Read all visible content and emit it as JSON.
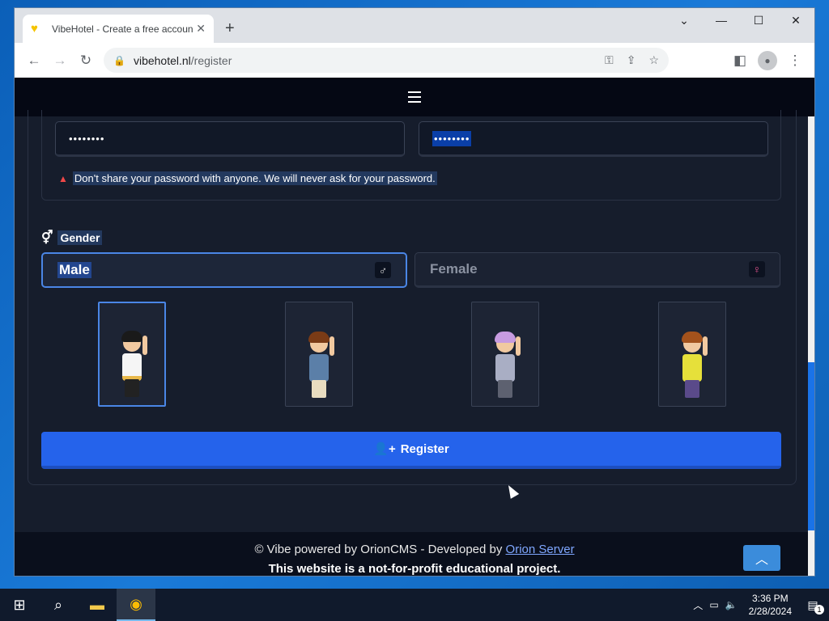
{
  "browser": {
    "tab_title": "VibeHotel - Create a free account",
    "tab_favicon": "heart-icon",
    "url_host": "vibehotel.nl",
    "url_path": "/register"
  },
  "page": {
    "password_masked": "••••••••",
    "password_confirm_masked": "••••••••",
    "password_warning": "Don't share your password with anyone. We will never ask for your password.",
    "gender_label": "Gender",
    "gender_male": "Male",
    "gender_female_placeholder": "Female",
    "gender_male_symbol": "♂",
    "gender_female_symbol": "♀",
    "avatars": [
      "avatar-1",
      "avatar-2",
      "avatar-3",
      "avatar-4"
    ],
    "selected_avatar": 0,
    "register_label": "Register"
  },
  "footer": {
    "line1_prefix": "© Vibe powered by OrionCMS - Developed by ",
    "line1_link": "Orion Server",
    "line2": "This website is a not-for-profit educational project."
  },
  "taskbar": {
    "time": "3:36 PM",
    "date": "2/28/2024",
    "notifications": "1"
  },
  "colors": {
    "page_bg": "#161d2c",
    "navbar": "#050814",
    "accent": "#2563eb",
    "female_icon": "#e7548f"
  }
}
